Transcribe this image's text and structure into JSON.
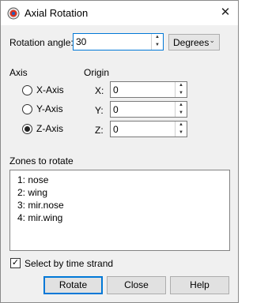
{
  "window": {
    "title": "Axial Rotation",
    "close_icon": "close-x-icon",
    "app_icon": "tecplot-app-icon"
  },
  "rotation": {
    "label": "Rotation angle:",
    "value": "30",
    "unit": "Degrees"
  },
  "axis": {
    "label": "Axis",
    "options": [
      "X-Axis",
      "Y-Axis",
      "Z-Axis"
    ],
    "selected": "Z-Axis"
  },
  "origin": {
    "label": "Origin",
    "x_label": "X:",
    "x_value": "0",
    "y_label": "Y:",
    "y_value": "0",
    "z_label": "Z:",
    "z_value": "0"
  },
  "zones": {
    "label": "Zones to rotate",
    "items": [
      "1: nose",
      "2: wing",
      "3: mir.nose",
      "4: mir.wing"
    ]
  },
  "time_strand": {
    "label": "Select by time strand",
    "checked": true
  },
  "buttons": {
    "rotate": "Rotate",
    "close": "Close",
    "help": "Help"
  },
  "colors": {
    "focus": "#0078d7",
    "window_bg": "#f0f0f0"
  }
}
